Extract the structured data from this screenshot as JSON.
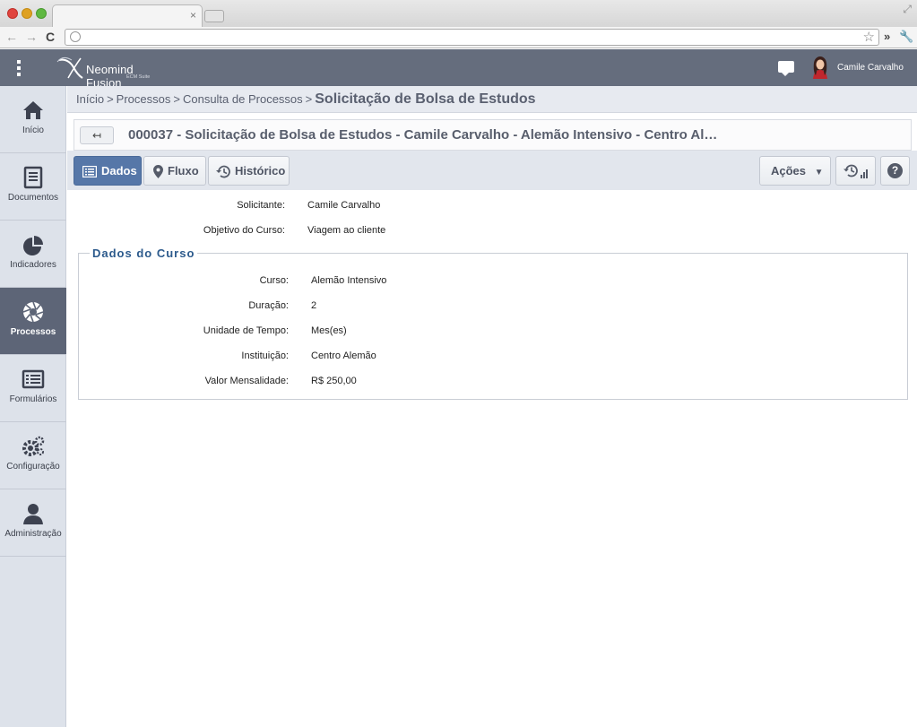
{
  "browser": {
    "tab_close": "×",
    "back": "←",
    "forward": "→",
    "reload": "C",
    "star": "☆",
    "more": "»"
  },
  "header": {
    "app_name": "Neomind Fusion",
    "app_sub": "ECM Suite",
    "user_name": "Camile Carvalho"
  },
  "sidebar": {
    "items": [
      {
        "label": "Início",
        "icon": "home-icon"
      },
      {
        "label": "Documentos",
        "icon": "document-icon"
      },
      {
        "label": "Indicadores",
        "icon": "pie-chart-icon"
      },
      {
        "label": "Processos",
        "icon": "aperture-icon",
        "active": true
      },
      {
        "label": "Formulários",
        "icon": "form-icon"
      },
      {
        "label": "Configuração",
        "icon": "gears-icon"
      },
      {
        "label": "Administração",
        "icon": "user-icon"
      }
    ]
  },
  "breadcrumb": {
    "items": [
      "Início",
      "Processos",
      "Consulta de Processos"
    ],
    "separator": ">",
    "current": "Solicitação de Bolsa de Estudos"
  },
  "title": {
    "back_label": "↤",
    "text": "000037 - Solicitação de Bolsa de Estudos - Camile Carvalho - Alemão Intensivo - Centro Al…"
  },
  "toolbar": {
    "tabs": [
      {
        "label": "Dados",
        "icon": "list-icon",
        "active": true
      },
      {
        "label": "Fluxo",
        "icon": "map-pin-icon"
      },
      {
        "label": "Histórico",
        "icon": "history-icon"
      }
    ],
    "actions_label": "Ações",
    "actions_caret": "▼",
    "help_label": "?"
  },
  "form": {
    "top_fields": [
      {
        "label": "Solicitante:",
        "value": "Camile Carvalho"
      },
      {
        "label": "Objetivo do Curso:",
        "value": "Viagem ao cliente"
      }
    ],
    "section_title": "Dados do Curso",
    "course_fields": [
      {
        "label": "Curso:",
        "value": "Alemão Intensivo"
      },
      {
        "label": "Duração:",
        "value": "2"
      },
      {
        "label": "Unidade de Tempo:",
        "value": "Mes(es)"
      },
      {
        "label": "Instituição:",
        "value": "Centro Alemão"
      },
      {
        "label": "Valor Mensalidade:",
        "value": "R$ 250,00"
      }
    ]
  },
  "colors": {
    "header_bg": "#656d7d",
    "active_tab": "#5677a8",
    "section_title": "#2c5a8c"
  }
}
